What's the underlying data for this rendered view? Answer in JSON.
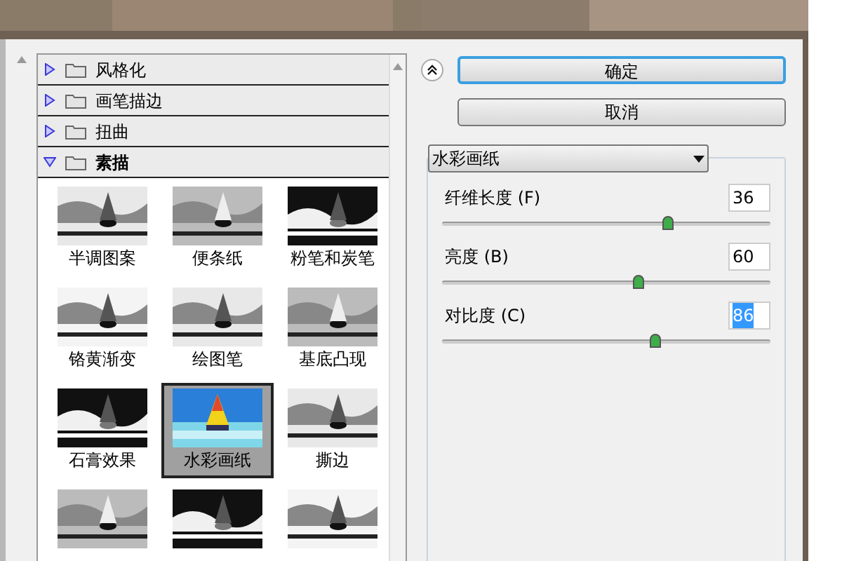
{
  "categories": [
    {
      "label": "风格化",
      "expanded": false
    },
    {
      "label": "画笔描边",
      "expanded": false
    },
    {
      "label": "扭曲",
      "expanded": false
    },
    {
      "label": "素描",
      "expanded": true,
      "filters": [
        {
          "label": "半调图案",
          "selected": false
        },
        {
          "label": "便条纸",
          "selected": false
        },
        {
          "label": "粉笔和炭笔",
          "selected": false
        },
        {
          "label": "铬黄渐变",
          "selected": false
        },
        {
          "label": "绘图笔",
          "selected": false
        },
        {
          "label": "基底凸现",
          "selected": false
        },
        {
          "label": "石膏效果",
          "selected": false
        },
        {
          "label": "水彩画纸",
          "selected": true
        },
        {
          "label": "撕边",
          "selected": false
        },
        {
          "selected": false
        },
        {
          "selected": false
        },
        {
          "selected": false
        }
      ]
    }
  ],
  "buttons": [
    {
      "label": "确定",
      "default": true
    },
    {
      "label": "取消",
      "default": false
    }
  ],
  "filter_dropdown": {
    "value": "水彩画纸"
  },
  "parameters": [
    {
      "label": "纤维长度 (F)",
      "value": "36",
      "level": 0.69,
      "selected": false
    },
    {
      "label": "亮度 (B)",
      "value": "60",
      "level": 0.6,
      "selected": false
    },
    {
      "label": "对比度 (C)",
      "value": "86",
      "level": 0.65,
      "selected": true
    }
  ]
}
